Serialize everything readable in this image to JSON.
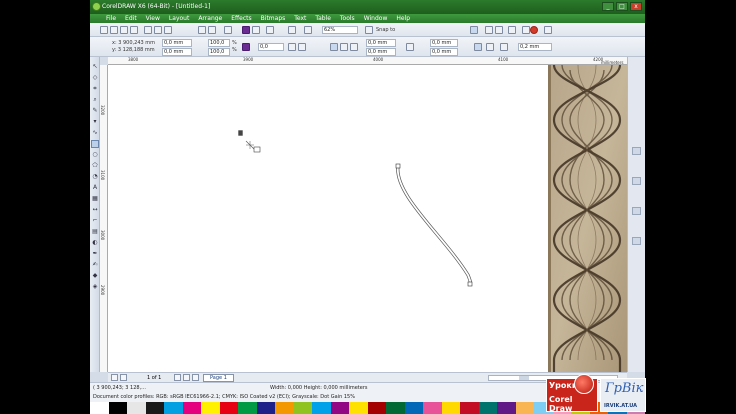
{
  "window": {
    "title": "CorelDRAW X6 (64-Bit) - [Untitled-1]",
    "controls": [
      "_",
      "□",
      "x"
    ]
  },
  "menu": [
    "File",
    "Edit",
    "View",
    "Layout",
    "Arrange",
    "Effects",
    "Bitmaps",
    "Text",
    "Table",
    "Tools",
    "Window",
    "Help"
  ],
  "toolbar": {
    "zoom": "62%",
    "snap_to": "Snap to"
  },
  "properties": {
    "x": "x: 3 900,243 mm",
    "y": "y: 3 128,188 mm",
    "width": "0,0 mm",
    "height": "0,0 mm",
    "scale_w": "100,0",
    "scale_h": "100,0",
    "scale_unit": "%",
    "angle": "0,0",
    "offset_x": "0,0 mm",
    "offset_y": "0,0 mm",
    "outline": "0,2 mm"
  },
  "rulers": {
    "units": "millimeters",
    "h_ticks": [
      "3800",
      "3900",
      "4000",
      "4100",
      "4200"
    ],
    "v_ticks": [
      "3200",
      "3100",
      "3000",
      "2900"
    ]
  },
  "page_nav": {
    "count": "1 of 1",
    "page_tab": "Page 1"
  },
  "status": {
    "coords": "( 3 900,243; 3 128,...",
    "dimensions": "Width: 0,000  Height: 0,000  millimeters",
    "profiles": "Document color profiles: RGB: sRGB IEC61966-2.1; CMYK: ISO Coated v2 (ECI); Grayscale: Dot Gain 15%"
  },
  "watermark": {
    "line1": "Уроки",
    "line2": "Corel Draw",
    "site_big": "ГрВік",
    "site_small": "IRVIK.AT.UA"
  },
  "colors": {
    "title_green": "#2c7a2c",
    "menu_green": "#3e9a3e",
    "accent_purple": "#6a2c91",
    "watermark_red": "#c9251b"
  },
  "palette": [
    "#ffffff",
    "#000000",
    "#e6e6e6",
    "#1a1a1a",
    "#00a0e3",
    "#e4007f",
    "#fff100",
    "#e60012",
    "#009944",
    "#1d2088",
    "#f39800",
    "#8fc31f",
    "#00a1e9",
    "#920783",
    "#ffe100",
    "#a40000",
    "#006934",
    "#0068b7",
    "#e85298",
    "#ffd900",
    "#c30d23",
    "#00736d",
    "#601986",
    "#f8b551",
    "#7ecef4",
    "#f19ec2",
    "#b4d200",
    "#eb6100",
    "#0075c2",
    "#cc7eb1"
  ]
}
